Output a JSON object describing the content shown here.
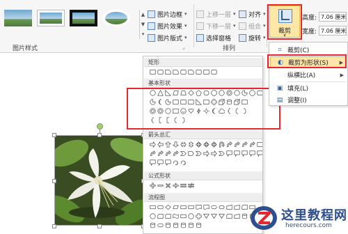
{
  "ribbon": {
    "picture_styles_group": "图片样式",
    "arrange_group": "排列",
    "picture_border": "图片边框",
    "picture_effects": "图片效果",
    "picture_layout": "图片版式",
    "bring_forward": "上移一层",
    "send_backward": "下移一层",
    "selection_pane": "选择窗格",
    "align": "对齐",
    "group": "组合",
    "rotate": "旋转",
    "crop": "裁剪",
    "height_label": "高度:",
    "height_value": "7.06 厘米",
    "width_label": "宽度:",
    "width_value": "7.06 厘米"
  },
  "shapes_gallery": {
    "categories": [
      "矩形",
      "基本形状",
      "箭头总汇",
      "公式形状",
      "流程图"
    ]
  },
  "crop_menu": {
    "items": [
      {
        "label": "裁剪(C)",
        "icon": "crop-icon"
      },
      {
        "label": "裁剪为形状(S)",
        "icon": "crop-to-shape-icon",
        "has_submenu": true,
        "highlighted": true
      },
      {
        "label": "纵横比(A)",
        "icon": "",
        "has_submenu": true
      },
      {
        "label": "填充(L)",
        "icon": "fill-icon"
      },
      {
        "label": "调整(I)",
        "icon": "fit-icon"
      }
    ]
  },
  "watermark": {
    "title": "这里教程网",
    "url": "herecours.com",
    "logo_icon": "z-logo-icon"
  },
  "colors": {
    "highlight_box": "#e8262d",
    "menu_highlight": "#fde6a8",
    "ribbon_bg": "#f6f6f6"
  }
}
